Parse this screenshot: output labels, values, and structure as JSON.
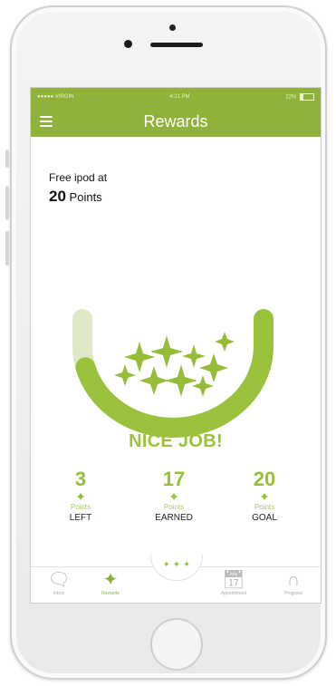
{
  "status_bar": {
    "carrier": "●●●●● VIRGIN",
    "time": "4:21 PM",
    "battery": "22%"
  },
  "nav": {
    "title": "Rewards",
    "menu_icon": "hamburger-icon"
  },
  "reward": {
    "description": "Free ipod at",
    "points_value": "20",
    "points_label": "Points"
  },
  "message": "NICE JOB!",
  "progress": {
    "earned_fraction": 0.85
  },
  "stats": [
    {
      "value": "3",
      "unit": "Points",
      "label": "LEFT"
    },
    {
      "value": "17",
      "unit": "Points",
      "label": "EARNED"
    },
    {
      "value": "20",
      "unit": "Points",
      "label": "GOAL"
    }
  ],
  "tabs": [
    {
      "label": "Inbox",
      "icon": "chat-icon"
    },
    {
      "label": "Rewards",
      "icon": "star-icon"
    },
    {
      "label": "",
      "icon": "stars-bowl-icon"
    },
    {
      "label": "Appointment",
      "icon": "calendar-icon"
    },
    {
      "label": "Progress",
      "icon": "arch-icon"
    }
  ],
  "colors": {
    "brand_green": "#8fb33a",
    "accent_green": "#9ac23c",
    "track_green": "#dfe9c7"
  }
}
